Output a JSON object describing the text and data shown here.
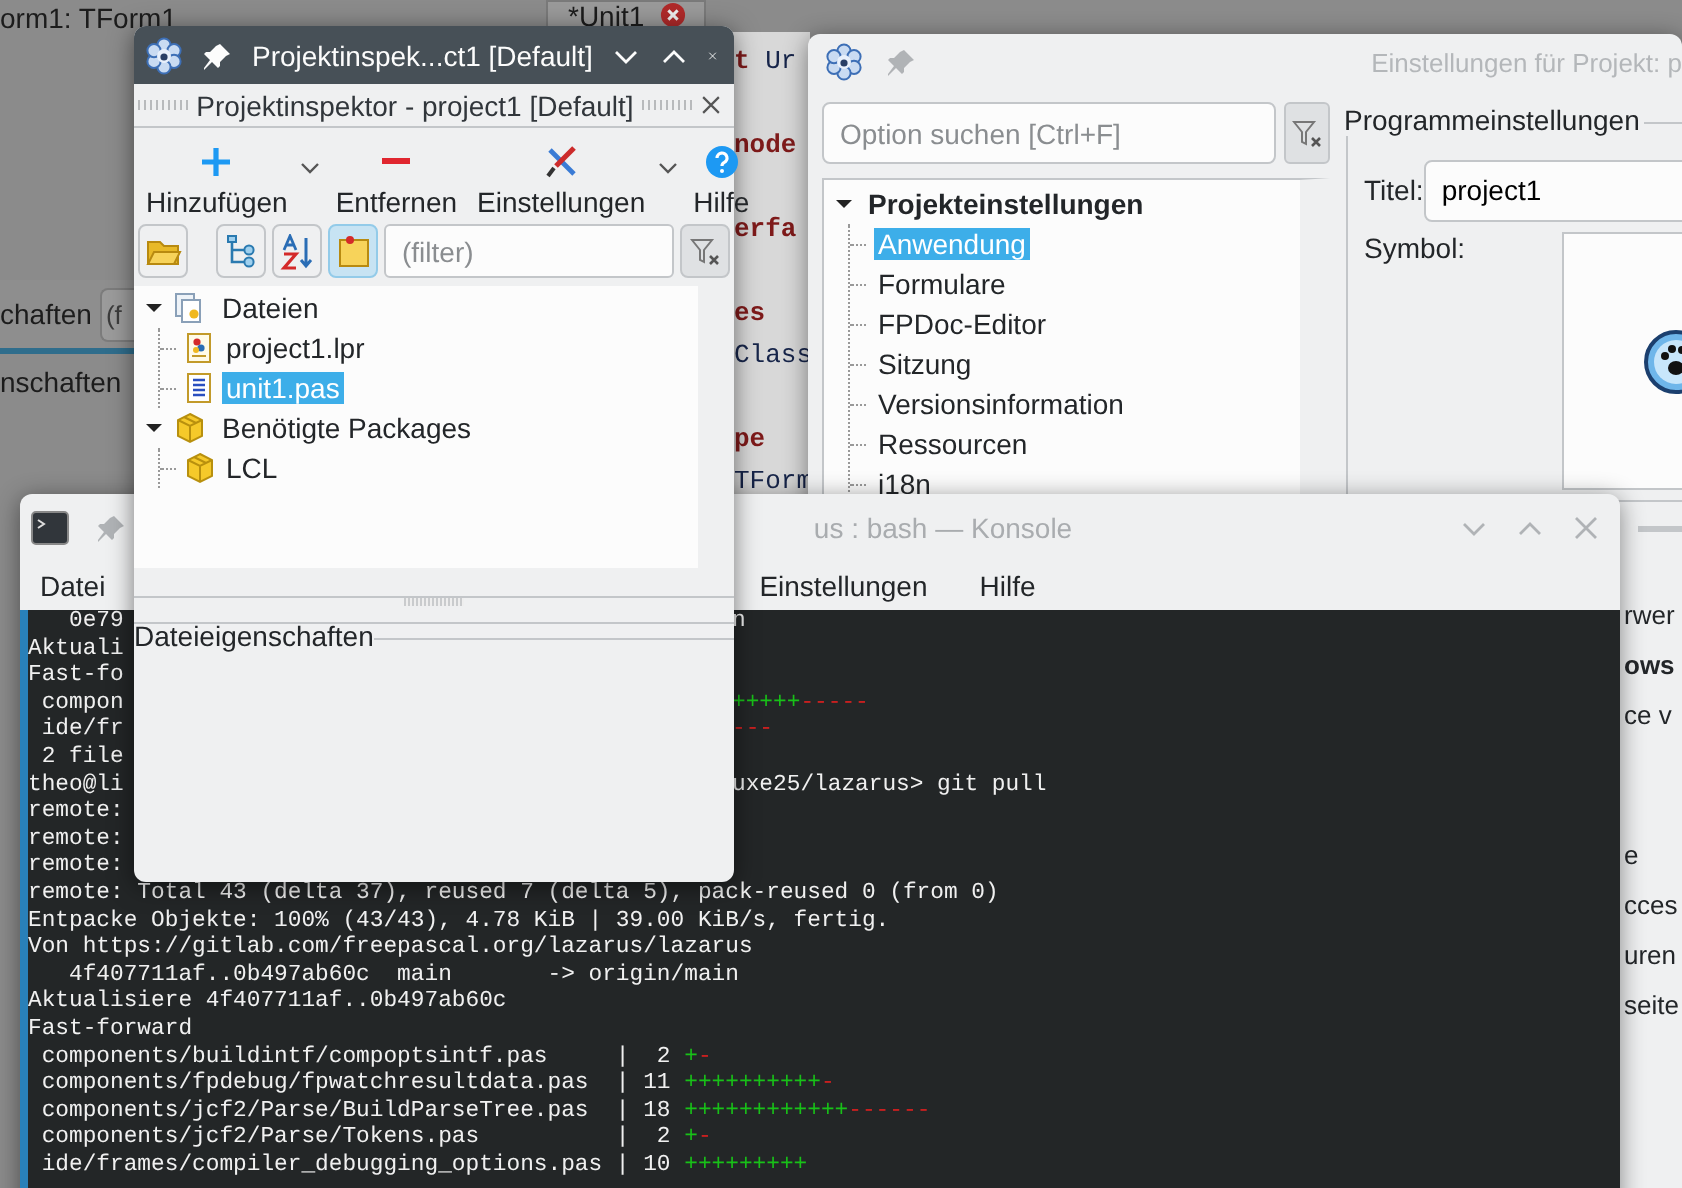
{
  "ide": {
    "form_title": "orm1: TForm1",
    "editor_tab": {
      "label": "*Unit1"
    },
    "object_inspector": {
      "tab_label": "chaften",
      "filter_field": "(f",
      "tab_label_2": "nschaften"
    },
    "code_blocks": [
      [
        "**t** Ur"
      ],
      [
        "**node**"
      ],
      [
        "**erfa**"
      ],
      [
        "**es**",
        "Class"
      ],
      [
        "**pe**",
        "TForm"
      ]
    ]
  },
  "project_options": {
    "window": {
      "title": "Einstellungen für Projekt: p"
    },
    "search": {
      "placeholder": "Option suchen [Ctrl+F]"
    },
    "tree": [
      {
        "label": "Projekteinstellungen",
        "expanded": true,
        "children": [
          {
            "label": "Anwendung",
            "selected": true
          },
          {
            "label": "Formulare",
            "selected": false
          },
          {
            "label": "FPDoc-Editor",
            "selected": false
          },
          {
            "label": "Sitzung",
            "selected": false
          },
          {
            "label": "Versionsinformation",
            "selected": false
          },
          {
            "label": "Ressourcen",
            "selected": false
          },
          {
            "label": "i18n",
            "selected": false
          }
        ]
      }
    ],
    "group": {
      "title": "Programmeinstellungen",
      "title_label": "Titel:",
      "title_value": "project1",
      "icon_label": "Symbol:"
    },
    "clipped_sections": [
      [
        {
          "text": "rwer",
          "bold": false
        },
        {
          "text": "ows",
          "bold": true
        },
        {
          "text": "ce v",
          "bold": false
        }
      ],
      [
        {
          "text": "e",
          "bold": false
        },
        {
          "text": "cces",
          "bold": false
        },
        {
          "text": "uren",
          "bold": false
        },
        {
          "text": "seite",
          "bold": false
        }
      ]
    ]
  },
  "konsole": {
    "window": {
      "title": "us : bash — Konsole"
    },
    "menu": [
      {
        "label": "Datei"
      },
      {
        "label": "Einstellungen"
      },
      {
        "label": "Hilfe"
      }
    ],
    "lines": [
      {
        "kind": "split",
        "left": "   0e79",
        "right": "n"
      },
      {
        "kind": "split",
        "left": "Aktuali"
      },
      {
        "kind": "split",
        "left": "Fast-fo"
      },
      {
        "kind": "split",
        "left": " compon",
        "plus": "+++++",
        "minus": "-----"
      },
      {
        "kind": "split",
        "left": " ide/fr",
        "minus": "---"
      },
      {
        "kind": "split",
        "left": " 2 file"
      },
      {
        "kind": "split",
        "left": "theo@li",
        "right": "uxe25/lazarus> git pull"
      },
      {
        "kind": "split",
        "left": "remote:"
      },
      {
        "kind": "split",
        "left": "remote:"
      },
      {
        "kind": "split",
        "left": "remote:"
      },
      {
        "kind": "full",
        "text": "remote: Total 43 (delta 37), reused 7 (delta 5), pack-reused 0 (from 0)"
      },
      {
        "kind": "full",
        "text": "Entpacke Objekte: 100% (43/43), 4.78 KiB | 39.00 KiB/s, fertig."
      },
      {
        "kind": "full",
        "text": "Von https://gitlab.com/freepascal.org/lazarus/lazarus"
      },
      {
        "kind": "full",
        "text": "   4f407711af..0b497ab60c  main       -> origin/main"
      },
      {
        "kind": "full",
        "text": "Aktualisiere 4f407711af..0b497ab60c"
      },
      {
        "kind": "full",
        "text": "Fast-forward"
      },
      {
        "kind": "full",
        "text": " components/buildintf/compoptsintf.pas     |  2 ",
        "plus": "+",
        "minus": "-"
      },
      {
        "kind": "full",
        "text": " components/fpdebug/fpwatchresultdata.pas  | 11 ",
        "plus": "++++++++++",
        "minus": "-"
      },
      {
        "kind": "full",
        "text": " components/jcf2/Parse/BuildParseTree.pas  | 18 ",
        "plus": "++++++++++++",
        "minus": "------"
      },
      {
        "kind": "full",
        "text": " components/jcf2/Parse/Tokens.pas          |  2 ",
        "plus": "+",
        "minus": "-"
      },
      {
        "kind": "full",
        "text": " ide/frames/compiler_debugging_options.pas | 10 ",
        "plus": "+++++++++"
      }
    ]
  },
  "project_inspector": {
    "window": {
      "title": "Projektinspek...ct1 [Default]"
    },
    "dock_title": "Projektinspektor - project1 [Default]",
    "toolbar": [
      {
        "label": "Hinzufügen",
        "kind": "add",
        "has_menu": true
      },
      {
        "label": "Entfernen",
        "kind": "remove",
        "has_menu": false
      },
      {
        "label": "Einstellungen",
        "kind": "options",
        "has_menu": true
      },
      {
        "label": "Hilfe",
        "kind": "help",
        "has_menu": false
      }
    ],
    "tool_buttons": [
      {
        "kind": "open",
        "pressed": false
      },
      {
        "kind": "tree",
        "pressed": false
      },
      {
        "kind": "sort",
        "pressed": false
      },
      {
        "kind": "note",
        "pressed": true
      }
    ],
    "filter": {
      "placeholder": "(filter)"
    },
    "tree": [
      {
        "label": "Dateien",
        "kind": "files",
        "expanded": true,
        "selected": false,
        "children": [
          {
            "label": "project1.lpr",
            "kind": "lpr",
            "selected": false
          },
          {
            "label": "unit1.pas",
            "kind": "pas",
            "selected": true
          }
        ]
      },
      {
        "label": "Benötigte Packages",
        "kind": "packages",
        "expanded": true,
        "selected": false,
        "children": [
          {
            "label": "LCL",
            "kind": "package",
            "selected": false
          }
        ]
      }
    ],
    "properties_group": "Dateieigenschaften"
  }
}
